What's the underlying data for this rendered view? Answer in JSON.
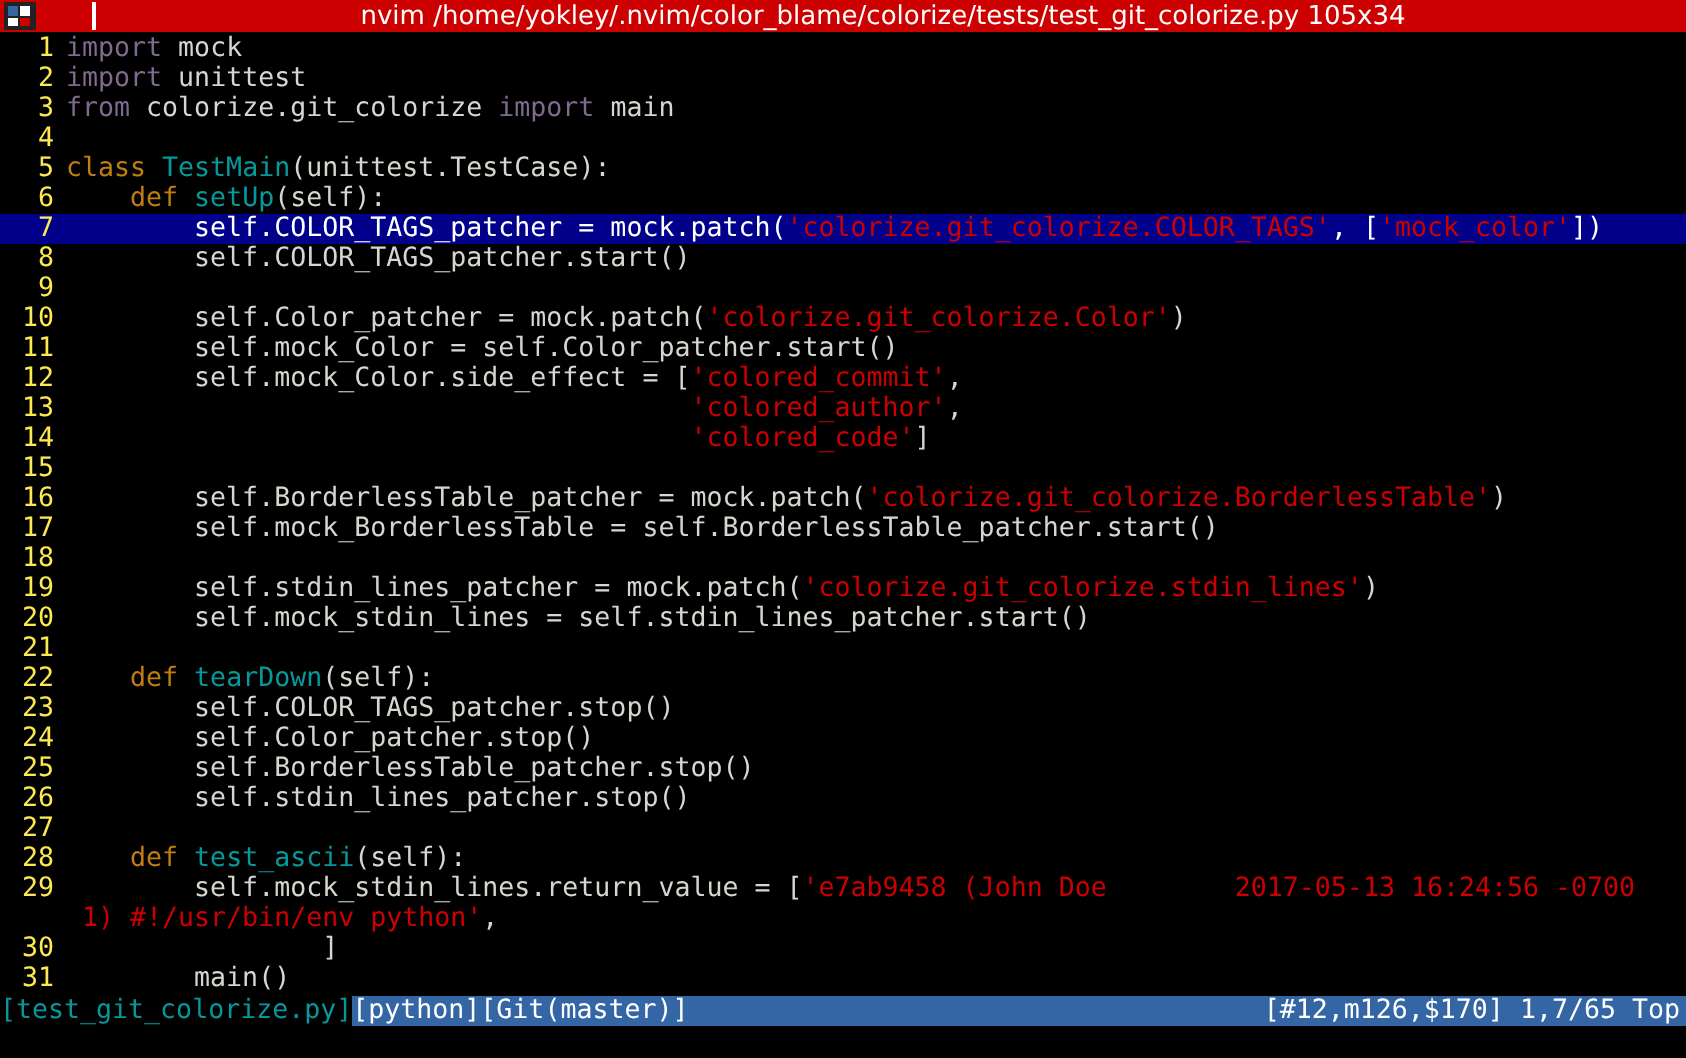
{
  "window": {
    "title": "nvim /home/yokley/.nvim/color_blame/colorize/tests/test_git_colorize.py 105x34"
  },
  "lines": [
    {
      "number": "1",
      "highlighted": false,
      "tokens": [
        {
          "kind": "import",
          "text": "import"
        },
        {
          "kind": "plain",
          "text": " mock"
        }
      ]
    },
    {
      "number": "2",
      "highlighted": false,
      "tokens": [
        {
          "kind": "import",
          "text": "import"
        },
        {
          "kind": "plain",
          "text": " unittest"
        }
      ]
    },
    {
      "number": "3",
      "highlighted": false,
      "tokens": [
        {
          "kind": "import",
          "text": "from"
        },
        {
          "kind": "plain",
          "text": " colorize.git_colorize "
        },
        {
          "kind": "import",
          "text": "import"
        },
        {
          "kind": "plain",
          "text": " main"
        }
      ]
    },
    {
      "number": "4",
      "highlighted": false
    },
    {
      "number": "5",
      "highlighted": false,
      "tokens": [
        {
          "kind": "keyword",
          "text": "class"
        },
        {
          "kind": "name",
          "text": " TestMain"
        },
        {
          "kind": "plain",
          "text": "(unittest.TestCase):"
        }
      ]
    },
    {
      "number": "6",
      "highlighted": false,
      "tokens": [
        {
          "kind": "keyword",
          "text": "    def"
        },
        {
          "kind": "name",
          "text": " setUp"
        },
        {
          "kind": "plain",
          "text": "(self):"
        }
      ]
    },
    {
      "number": "7",
      "highlighted": true,
      "tokens": [
        {
          "kind": "plain",
          "text": "        self.COLOR_TAGS_patcher = mock.patch("
        },
        {
          "kind": "string",
          "text": "'colorize.git_colorize.COLOR_TAGS'"
        },
        {
          "kind": "plain",
          "text": ", ["
        },
        {
          "kind": "string",
          "text": "'mock_color'"
        },
        {
          "kind": "plain",
          "text": "])"
        }
      ]
    },
    {
      "number": "8",
      "highlighted": false,
      "tokens": [
        {
          "kind": "plain",
          "text": "        self.COLOR_TAGS_patcher.start()"
        }
      ]
    },
    {
      "number": "9",
      "highlighted": false
    },
    {
      "number": "10",
      "highlighted": false,
      "tokens": [
        {
          "kind": "plain",
          "text": "        self.Color_patcher = mock.patch("
        },
        {
          "kind": "string",
          "text": "'colorize.git_colorize.Color'"
        },
        {
          "kind": "plain",
          "text": ")"
        }
      ]
    },
    {
      "number": "11",
      "highlighted": false,
      "tokens": [
        {
          "kind": "plain",
          "text": "        self.mock_Color = self.Color_patcher.start()"
        }
      ]
    },
    {
      "number": "12",
      "highlighted": false,
      "tokens": [
        {
          "kind": "plain",
          "text": "        self.mock_Color.side_effect = ["
        },
        {
          "kind": "string",
          "text": "'colored_commit'"
        },
        {
          "kind": "plain",
          "text": ","
        }
      ]
    },
    {
      "number": "13",
      "highlighted": false,
      "tokens": [
        {
          "kind": "string",
          "text": "                                       'colored_author'"
        },
        {
          "kind": "plain",
          "text": ","
        }
      ]
    },
    {
      "number": "14",
      "highlighted": false,
      "tokens": [
        {
          "kind": "string",
          "text": "                                       'colored_code'"
        },
        {
          "kind": "plain",
          "text": "]"
        }
      ]
    },
    {
      "number": "15",
      "highlighted": false
    },
    {
      "number": "16",
      "highlighted": false,
      "tokens": [
        {
          "kind": "plain",
          "text": "        self.BorderlessTable_patcher = mock.patch("
        },
        {
          "kind": "string",
          "text": "'colorize.git_colorize.BorderlessTable'"
        },
        {
          "kind": "plain",
          "text": ")"
        }
      ]
    },
    {
      "number": "17",
      "highlighted": false,
      "tokens": [
        {
          "kind": "plain",
          "text": "        self.mock_BorderlessTable = self.BorderlessTable_patcher.start()"
        }
      ]
    },
    {
      "number": "18",
      "highlighted": false
    },
    {
      "number": "19",
      "highlighted": false,
      "tokens": [
        {
          "kind": "plain",
          "text": "        self.stdin_lines_patcher = mock.patch("
        },
        {
          "kind": "string",
          "text": "'colorize.git_colorize.stdin_lines'"
        },
        {
          "kind": "plain",
          "text": ")"
        }
      ]
    },
    {
      "number": "20",
      "highlighted": false,
      "tokens": [
        {
          "kind": "plain",
          "text": "        self.mock_stdin_lines = self.stdin_lines_patcher.start()"
        }
      ]
    },
    {
      "number": "21",
      "highlighted": false
    },
    {
      "number": "22",
      "highlighted": false,
      "tokens": [
        {
          "kind": "keyword",
          "text": "    def"
        },
        {
          "kind": "name",
          "text": " tearDown"
        },
        {
          "kind": "plain",
          "text": "(self):"
        }
      ]
    },
    {
      "number": "23",
      "highlighted": false,
      "tokens": [
        {
          "kind": "plain",
          "text": "        self.COLOR_TAGS_patcher.stop()"
        }
      ]
    },
    {
      "number": "24",
      "highlighted": false,
      "tokens": [
        {
          "kind": "plain",
          "text": "        self.Color_patcher.stop()"
        }
      ]
    },
    {
      "number": "25",
      "highlighted": false,
      "tokens": [
        {
          "kind": "plain",
          "text": "        self.BorderlessTable_patcher.stop()"
        }
      ]
    },
    {
      "number": "26",
      "highlighted": false,
      "tokens": [
        {
          "kind": "plain",
          "text": "        self.stdin_lines_patcher.stop()"
        }
      ]
    },
    {
      "number": "27",
      "highlighted": false
    },
    {
      "number": "28",
      "highlighted": false,
      "tokens": [
        {
          "kind": "keyword",
          "text": "    def"
        },
        {
          "kind": "name",
          "text": " test_ascii"
        },
        {
          "kind": "plain",
          "text": "(self):"
        }
      ]
    },
    {
      "number": "29",
      "highlighted": false,
      "tokens": [
        {
          "kind": "plain",
          "text": "        self.mock_stdin_lines.return_value = ["
        },
        {
          "kind": "string",
          "text": "'e7ab9458 (John Doe        2017-05-13 16:24:56 -0700"
        }
      ],
      "wrapped": [
        {
          "kind": "string",
          "text": " 1) #!/usr/bin/env python'"
        },
        {
          "kind": "plain",
          "text": ","
        }
      ]
    },
    {
      "number": "30",
      "highlighted": false,
      "tokens": [
        {
          "kind": "plain",
          "text": "                ]"
        }
      ]
    },
    {
      "number": "31",
      "highlighted": false,
      "tokens": [
        {
          "kind": "plain",
          "text": "        main()"
        }
      ]
    }
  ],
  "status_bar": {
    "file": "[test_git_colorize.py]",
    "filetype": "[python][Git(master)]",
    "position": "[#12,m126,$170] 1,7/65 Top"
  }
}
